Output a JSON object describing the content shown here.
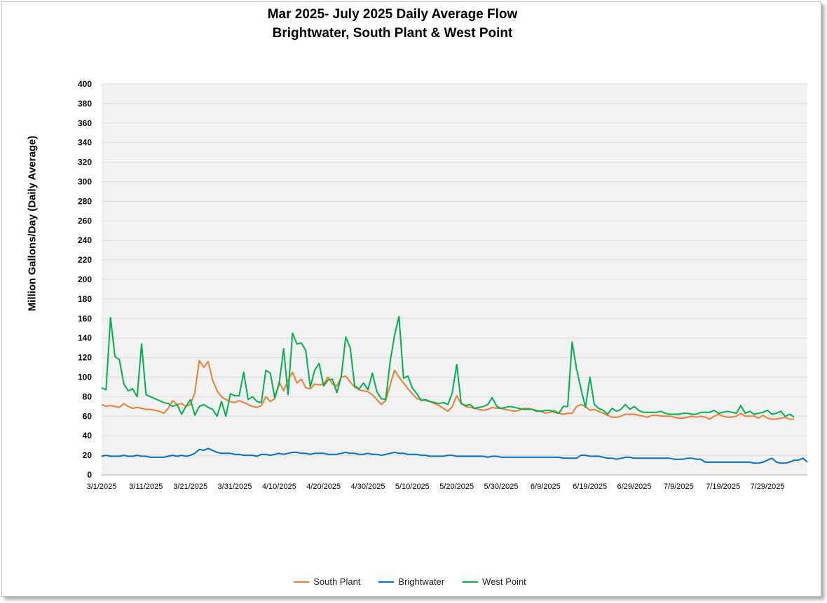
{
  "chart_data": {
    "type": "line",
    "title": "Mar 2025- July 2025 Daily Average Flow",
    "subtitle": "Brightwater, South Plant & West Point",
    "ylabel": "Million Gallons/Day (Daily Average)",
    "xlabel": "",
    "ylim": [
      0,
      400
    ],
    "yticks": [
      0,
      20,
      40,
      60,
      80,
      100,
      120,
      140,
      160,
      180,
      200,
      220,
      240,
      260,
      280,
      300,
      320,
      340,
      360,
      380,
      400
    ],
    "x_start": "3/1/2025",
    "x_end": "7/31/2025",
    "xtick_labels": [
      "3/1/2025",
      "3/11/2025",
      "3/21/2025",
      "3/31/2025",
      "4/10/2025",
      "4/20/2025",
      "4/30/2025",
      "5/10/2025",
      "5/20/2025",
      "5/30/2025",
      "6/9/2025",
      "6/19/2025",
      "6/29/2025",
      "7/9/2025",
      "7/19/2025",
      "7/29/2025"
    ],
    "grid": true,
    "legend_position": "bottom",
    "series": [
      {
        "name": "South Plant",
        "color": "#ED7D31",
        "values": [
          72,
          70,
          71,
          70,
          69,
          73,
          70,
          68,
          69,
          68,
          67,
          67,
          66,
          65,
          63,
          68,
          76,
          72,
          73,
          70,
          72,
          84,
          117,
          110,
          116,
          97,
          86,
          80,
          77,
          75,
          74,
          76,
          74,
          72,
          70,
          69,
          71,
          80,
          75,
          78,
          95,
          86,
          97,
          105,
          94,
          98,
          89,
          88,
          93,
          92,
          93,
          100,
          93,
          91,
          100,
          101,
          95,
          90,
          87,
          86,
          85,
          82,
          77,
          72,
          76,
          92,
          107,
          100,
          94,
          88,
          83,
          78,
          77,
          76,
          75,
          73,
          71,
          68,
          65,
          70,
          81,
          73,
          70,
          69,
          68,
          67,
          66,
          67,
          69,
          68,
          68,
          67,
          66,
          65,
          66,
          68,
          68,
          67,
          66,
          65,
          63,
          64,
          66,
          63,
          62,
          63,
          63,
          70,
          72,
          70,
          66,
          67,
          65,
          63,
          61,
          59,
          59,
          60,
          62,
          62,
          62,
          61,
          60,
          59,
          61,
          61,
          60,
          60,
          60,
          59,
          58,
          58,
          59,
          60,
          59,
          60,
          59,
          57,
          60,
          62,
          60,
          59,
          59,
          60,
          63,
          60,
          60,
          60,
          58,
          61,
          58,
          57,
          57,
          58,
          59,
          57,
          57
        ]
      },
      {
        "name": "Brightwater",
        "color": "#0070C0",
        "values": [
          19,
          20,
          19,
          19,
          19,
          20,
          19,
          19,
          20,
          19,
          19,
          18,
          18,
          18,
          18,
          19,
          20,
          19,
          20,
          19,
          20,
          22,
          26,
          25,
          27,
          25,
          23,
          22,
          22,
          22,
          21,
          21,
          20,
          20,
          20,
          19,
          21,
          21,
          20,
          21,
          22,
          21,
          22,
          23,
          23,
          22,
          22,
          21,
          22,
          22,
          22,
          21,
          21,
          21,
          22,
          23,
          22,
          22,
          21,
          21,
          22,
          21,
          21,
          20,
          21,
          22,
          23,
          22,
          22,
          21,
          21,
          21,
          20,
          20,
          19,
          19,
          19,
          19,
          20,
          20,
          19,
          19,
          19,
          19,
          19,
          19,
          19,
          18,
          19,
          19,
          18,
          18,
          18,
          18,
          18,
          18,
          18,
          18,
          18,
          18,
          18,
          18,
          18,
          18,
          17,
          17,
          17,
          17,
          20,
          20,
          19,
          19,
          19,
          18,
          17,
          17,
          16,
          17,
          18,
          18,
          17,
          17,
          17,
          17,
          17,
          17,
          17,
          17,
          17,
          16,
          16,
          16,
          17,
          17,
          16,
          16,
          13,
          13,
          13,
          13,
          13,
          13,
          13,
          13,
          13,
          13,
          13,
          12,
          12,
          13,
          15,
          17,
          13,
          12,
          12,
          13,
          15,
          15,
          17,
          13
        ]
      },
      {
        "name": "West Point",
        "color": "#00B050",
        "values": [
          89,
          87,
          161,
          121,
          118,
          93,
          86,
          88,
          80,
          134,
          82,
          80,
          78,
          76,
          74,
          73,
          70,
          72,
          62,
          70,
          77,
          61,
          70,
          72,
          69,
          67,
          60,
          75,
          60,
          83,
          81,
          81,
          105,
          77,
          80,
          75,
          74,
          107,
          104,
          79,
          93,
          129,
          82,
          145,
          134,
          135,
          127,
          90,
          107,
          114,
          91,
          97,
          98,
          84,
          101,
          141,
          130,
          91,
          88,
          94,
          87,
          104,
          85,
          78,
          77,
          116,
          143,
          162,
          99,
          101,
          89,
          83,
          76,
          77,
          75,
          74,
          73,
          74,
          72,
          84,
          113,
          73,
          71,
          72,
          68,
          69,
          70,
          72,
          79,
          70,
          68,
          69,
          70,
          69,
          68,
          67,
          67,
          67,
          65,
          65,
          66,
          66,
          64,
          63,
          70,
          70,
          136,
          108,
          88,
          69,
          100,
          72,
          68,
          66,
          62,
          68,
          65,
          67,
          72,
          67,
          70,
          66,
          64,
          64,
          64,
          64,
          65,
          63,
          62,
          62,
          62,
          63,
          63,
          62,
          62,
          64,
          64,
          64,
          66,
          63,
          64,
          65,
          64,
          63,
          71,
          63,
          65,
          62,
          63,
          64,
          66,
          62,
          63,
          65,
          60,
          62,
          59
        ]
      }
    ]
  }
}
